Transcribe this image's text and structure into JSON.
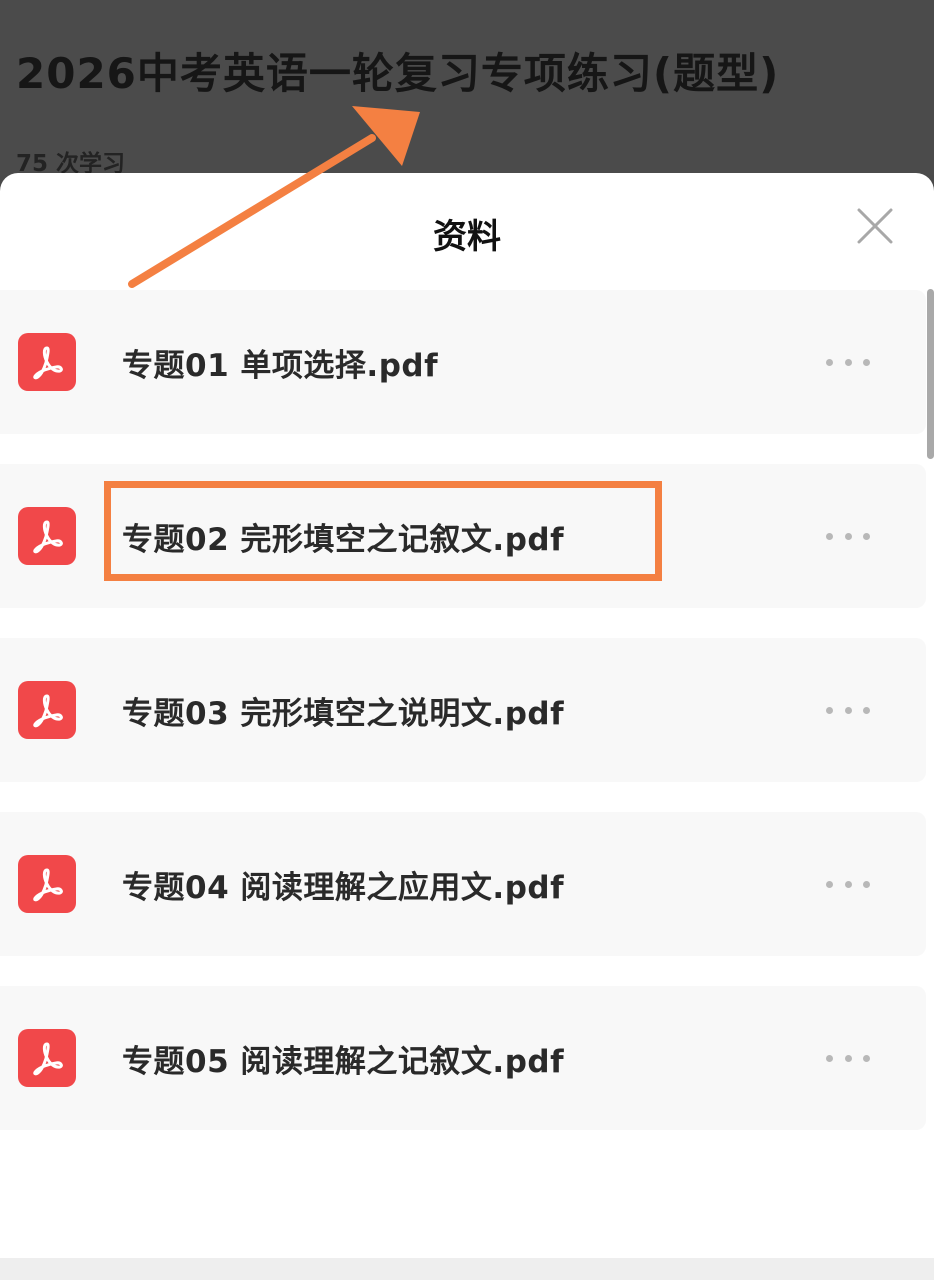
{
  "course": {
    "title": "2026中考英语一轮复习专项练习(题型)",
    "study_count": "75 次学习"
  },
  "sheet": {
    "title": "资料",
    "close_icon": "close-icon"
  },
  "files": [
    {
      "name": "专题01 单项选择.pdf",
      "icon": "pdf-icon"
    },
    {
      "name": "专题02 完形填空之记叙文.pdf",
      "icon": "pdf-icon"
    },
    {
      "name": "专题03 完形填空之说明文.pdf",
      "icon": "pdf-icon"
    },
    {
      "name": "专题04 阅读理解之应用文.pdf",
      "icon": "pdf-icon"
    },
    {
      "name": "专题05 阅读理解之记叙文.pdf",
      "icon": "pdf-icon"
    }
  ],
  "more_icon": "more-dots-icon",
  "colors": {
    "pdf_red": "#f1484a",
    "annotation_orange": "#f48042",
    "backdrop": "#4b4b4b"
  },
  "annotations": {
    "highlighted_item": "专题02 完形填空之记叙文.pdf",
    "arrow_points_to": "course-title"
  }
}
